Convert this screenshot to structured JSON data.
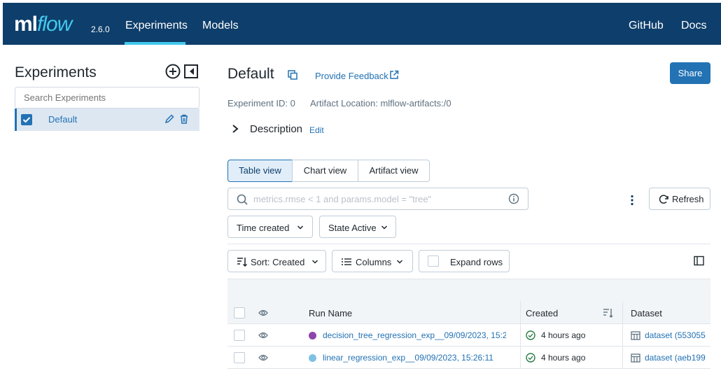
{
  "nav": {
    "logo_ml": "ml",
    "logo_flow": "flow",
    "version": "2.6.0",
    "items": [
      "Experiments",
      "Models"
    ],
    "right_items": [
      "GitHub",
      "Docs"
    ]
  },
  "sidebar": {
    "title": "Experiments",
    "search_placeholder": "Search Experiments",
    "items": [
      {
        "label": "Default",
        "checked": true
      }
    ]
  },
  "header": {
    "title": "Default",
    "feedback_label": "Provide Feedback",
    "share_label": "Share",
    "experiment_id": "Experiment ID: 0",
    "artifact_location": "Artifact Location: mlflow-artifacts:/0",
    "description_label": "Description",
    "edit_label": "Edit"
  },
  "views": {
    "tabs": [
      "Table view",
      "Chart view",
      "Artifact view"
    ],
    "active": "Table view"
  },
  "search": {
    "placeholder": "metrics.rmse < 1 and params.model = \"tree\"",
    "refresh_label": "Refresh"
  },
  "filters": {
    "time": "Time created",
    "state": "State Active"
  },
  "toolbar": {
    "sort": "Sort: Created",
    "columns": "Columns",
    "expand": "Expand rows"
  },
  "table": {
    "headers": [
      "Run Name",
      "Created",
      "Dataset"
    ],
    "rows": [
      {
        "run_name": "decision_tree_regression_exp__09/09/2023, 15:2...",
        "color": "#8e44ad",
        "created": "4 hours ago",
        "dataset": "dataset (553055"
      },
      {
        "run_name": "linear_regression_exp__09/09/2023, 15:26:11",
        "color": "#7fc1e4",
        "created": "4 hours ago",
        "dataset": "dataset (aeb199"
      }
    ]
  },
  "colors": {
    "nav_bg": "#0e3e6b",
    "accent": "#2272b4",
    "nav_active": "#43c9ed",
    "success": "#277c43"
  }
}
